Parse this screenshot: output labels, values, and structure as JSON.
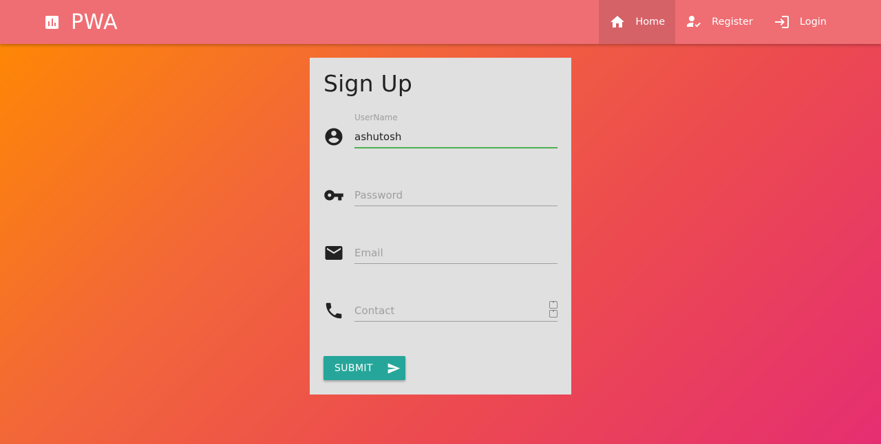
{
  "navbar": {
    "brand_icon": "bar-chart-icon",
    "brand_title": "PWA",
    "items": [
      {
        "label": "Home",
        "icon": "home-icon",
        "active": true
      },
      {
        "label": "Register",
        "icon": "person-check-icon",
        "active": false
      },
      {
        "label": "Login",
        "icon": "login-icon",
        "active": false
      }
    ]
  },
  "form": {
    "title": "Sign Up",
    "username": {
      "label": "UserName",
      "value": "ashutosh",
      "icon": "account-circle-icon"
    },
    "password": {
      "placeholder": "Password",
      "value": "",
      "icon": "key-icon"
    },
    "email": {
      "placeholder": "Email",
      "value": "",
      "icon": "mail-icon"
    },
    "contact": {
      "placeholder": "Contact",
      "value": "",
      "icon": "phone-icon"
    },
    "submit_label": "SUBMIT",
    "submit_icon": "send-icon"
  },
  "colors": {
    "navbar": "#ee6e73",
    "card": "#e0e0e0",
    "submit": "#26a69a",
    "focus_underline": "#4caf50",
    "gradient_start": "#ff8a00",
    "gradient_end": "#e52e71"
  }
}
